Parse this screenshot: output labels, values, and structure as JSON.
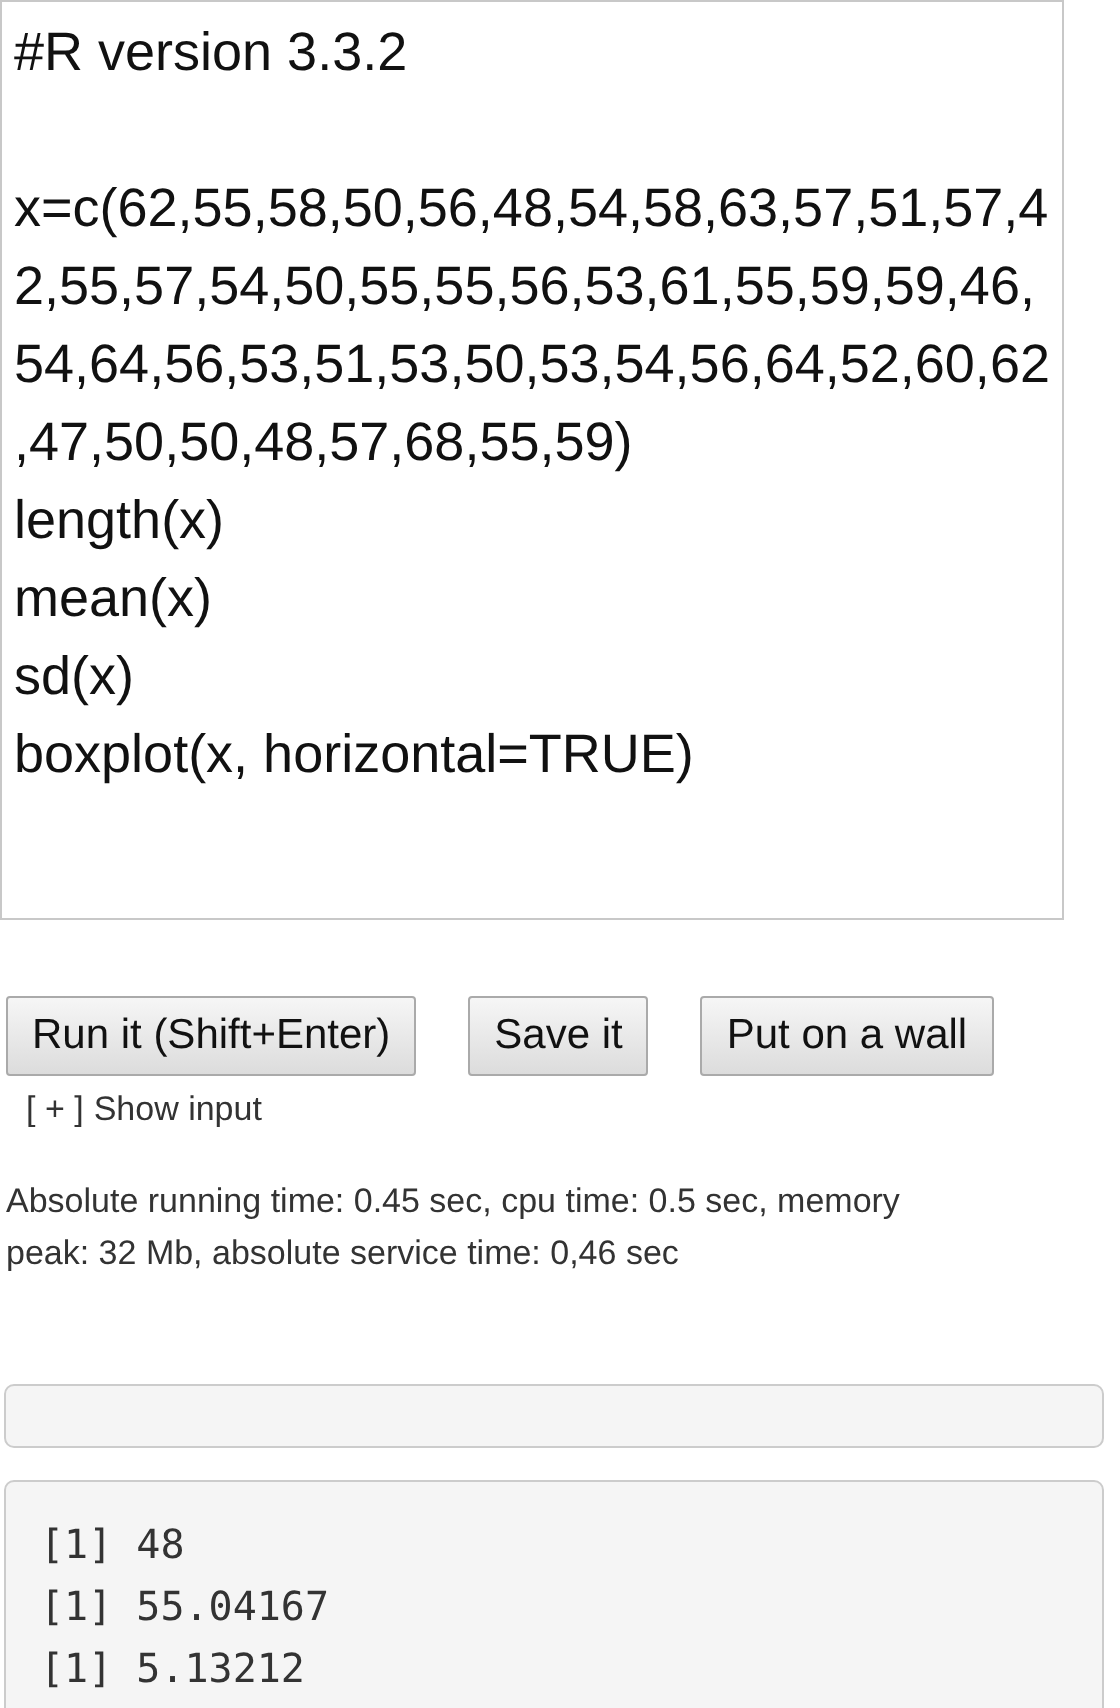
{
  "editor": {
    "blocks": [
      [
        "#R version 3.3.2"
      ],
      [
        "x=c(62,55,58,50,56,48,54,58,63,57,51,57,4",
        "2,55,57,54,50,55,55,56,53,61,55,59,59,46,",
        "54,64,56,53,51,53,50,53,54,56,64,52,60,62",
        ",47,50,50,48,57,68,55,59)",
        "length(x)",
        "mean(x)",
        "sd(x)",
        "boxplot(x, horizontal=TRUE)"
      ]
    ]
  },
  "buttons": [
    "Run it (Shift+Enter)",
    "Save it",
    "Put on a wall"
  ],
  "show_input": {
    "marker": "[ + ]",
    "label": "Show input"
  },
  "timing": "Absolute running time: 0.45 sec, cpu time: 0.5 sec, memory peak: 32 Mb, absolute service time: 0,46 sec",
  "output": [
    "[1] 48",
    "[1] 55.04167",
    "[1] 5.13212"
  ]
}
